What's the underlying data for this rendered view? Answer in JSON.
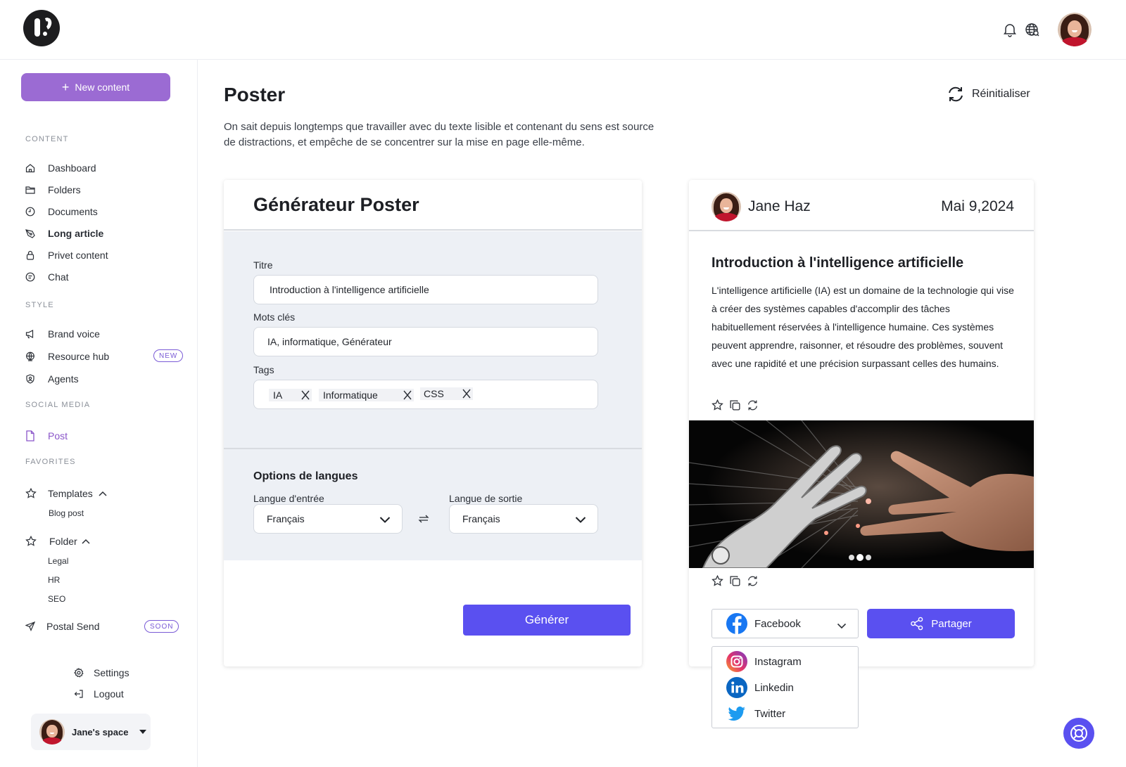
{
  "header": {
    "logo_icon": "brand-logo",
    "notification_icon": "bell-icon",
    "language_icon": "globe-icon"
  },
  "sidebar": {
    "new_content": "New content",
    "sections": {
      "content": "CONTENT",
      "style": "STYLE",
      "social": "SOCIAL MEDIA",
      "favorites": "FAVORITES"
    },
    "content_items": [
      "Dashboard",
      "Folders",
      "Documents",
      "Long article",
      "Privet content",
      "Chat"
    ],
    "style_items": [
      "Brand voice",
      "Resource hub",
      "Agents"
    ],
    "new_badge": "NEW",
    "social_items": [
      "Post"
    ],
    "templates": "Templates",
    "templates_sub": [
      "Blog post"
    ],
    "folder": "Folder",
    "folder_sub": [
      "Legal",
      "HR",
      "SEO"
    ],
    "postal_send": "Postal Send",
    "soon_badge": "SOON",
    "settings": "Settings",
    "logout": "Logout",
    "space": "Jane's space"
  },
  "main": {
    "title": "Poster",
    "description": "On sait depuis longtemps que travailler avec du texte lisible et contenant du sens est source de distractions, et empêche de se concentrer sur la mise en page elle-même.",
    "reset": "Réinitialiser"
  },
  "generator": {
    "title": "Générateur Poster",
    "titre_label": "Titre",
    "titre_value": "Introduction à l'intelligence artificielle",
    "keywords_label": "Mots clés",
    "keywords_value": "IA, informatique, Générateur",
    "tags_label": "Tags",
    "tags": [
      "IA",
      "Informatique",
      "CSS"
    ],
    "options_title": "Options de langues",
    "input_lang_label": "Langue d'entrée",
    "input_lang_value": "Français",
    "output_lang_label": "Langue de sortie",
    "output_lang_value": "Français",
    "generate": "Générer"
  },
  "preview": {
    "author": "Jane Haz",
    "date": "Mai 9,2024",
    "title": "Introduction à l'intelligence artificielle",
    "body": "L'intelligence artificielle (IA) est un domaine de la technologie qui vise à créer des systèmes capables d'accomplir des tâches habituellement réservées à l'intelligence humaine. Ces systèmes peuvent apprendre, raisonner, et résoudre des problèmes, souvent avec une rapidité et une précision surpassant celles des humains.",
    "network_selected": "Facebook",
    "share": "Partager",
    "networks": [
      "Instagram",
      "Linkedin",
      "Twitter"
    ]
  },
  "colors": {
    "accent": "#5a50f0",
    "sidebar_button": "#9b6bd3",
    "panel_bg": "#edf0f5"
  }
}
